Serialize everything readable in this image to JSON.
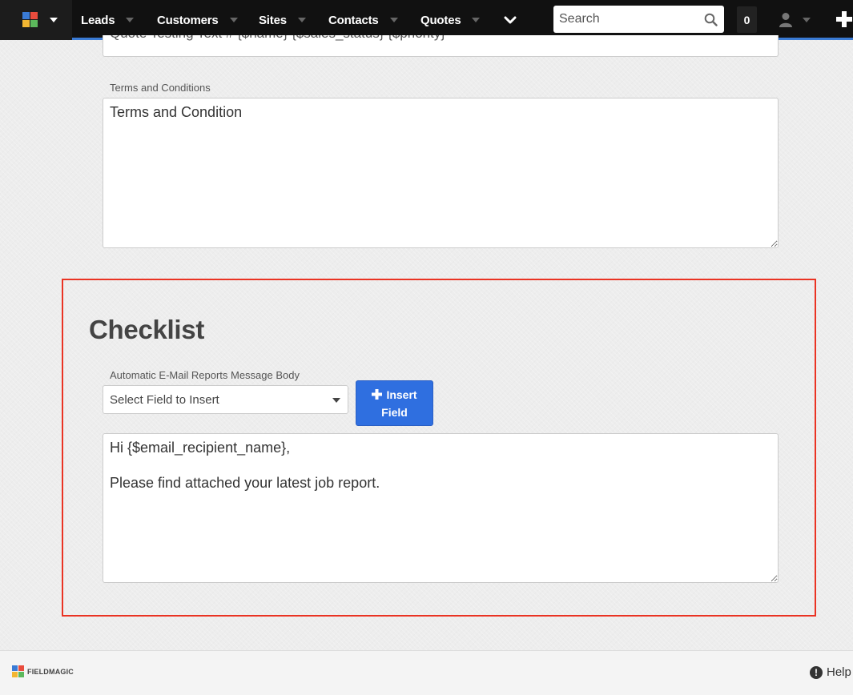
{
  "navbar": {
    "brand_icon": "fieldmagic-logo-icon",
    "items": [
      {
        "label": "Leads"
      },
      {
        "label": "Customers"
      },
      {
        "label": "Sites"
      },
      {
        "label": "Contacts"
      },
      {
        "label": "Quotes"
      }
    ],
    "more_icon": "chevron-down-icon",
    "search": {
      "placeholder": "Search",
      "icon": "search-icon"
    },
    "notification_count": "0",
    "user_icon": "user-icon",
    "add_icon": "plus-icon",
    "accent_color": "#3a7bd5"
  },
  "form": {
    "truncated_field_value": "Quote Testing Text #  {$name}  {$sales_status} {$priority}",
    "terms": {
      "label": "Terms and Conditions",
      "value": "Terms and Condition"
    },
    "checklist": {
      "title": "Checklist",
      "highlight_color": "#ea3323",
      "email_body_label": "Automatic E-Mail Reports Message Body",
      "select_placeholder": "Select Field to Insert",
      "insert_button": {
        "line1": "Insert",
        "line2": "Field",
        "icon": "plus-icon"
      },
      "body_value": "Hi {$email_recipient_name},\n\nPlease find attached your latest job report."
    }
  },
  "footer": {
    "logo_text": "FIELDMAGIC",
    "help_label": "Help",
    "help_icon": "exclamation-circle-icon"
  }
}
